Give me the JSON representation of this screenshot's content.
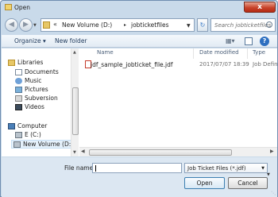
{
  "window": {
    "title": "Open",
    "close_label": "x"
  },
  "nav": {
    "address_segments": [
      "«",
      "New Volume (D:)",
      "▸",
      "jobticketfiles"
    ],
    "search_placeholder": "Search jobticketfiles"
  },
  "toolbar": {
    "organize_label": "Organize ▾",
    "new_folder_label": "New folder"
  },
  "sidebar": {
    "items": [
      {
        "label": "Libraries",
        "icon": "libraries-icon"
      },
      {
        "label": "Documents",
        "icon": "documents-icon"
      },
      {
        "label": "Music",
        "icon": "music-icon"
      },
      {
        "label": "Pictures",
        "icon": "pictures-icon"
      },
      {
        "label": "Subversion",
        "icon": "subversion-icon"
      },
      {
        "label": "Videos",
        "icon": "videos-icon"
      },
      {
        "label": "Computer",
        "icon": "computer-icon"
      },
      {
        "label": "E (C:)",
        "icon": "drive-icon"
      },
      {
        "label": "New Volume (D:)",
        "icon": "drive-icon",
        "selected": true
      }
    ]
  },
  "file_list": {
    "columns": [
      "Name",
      "Date modified",
      "Type"
    ],
    "rows": [
      {
        "name": "jdf_sample_jobticket_file.jdf",
        "date": "2017/07/07 18:39",
        "type": "Job Defini"
      }
    ]
  },
  "footer": {
    "file_name_label": "File name:",
    "file_name_value": "",
    "filter_label": "Job Ticket Files (*.jdf)",
    "open_label": "Open",
    "cancel_label": "Cancel"
  },
  "colors": {
    "close_red": "#c8432b",
    "accent_blue": "#2d6fc0",
    "window_frame": "#c9daea"
  }
}
